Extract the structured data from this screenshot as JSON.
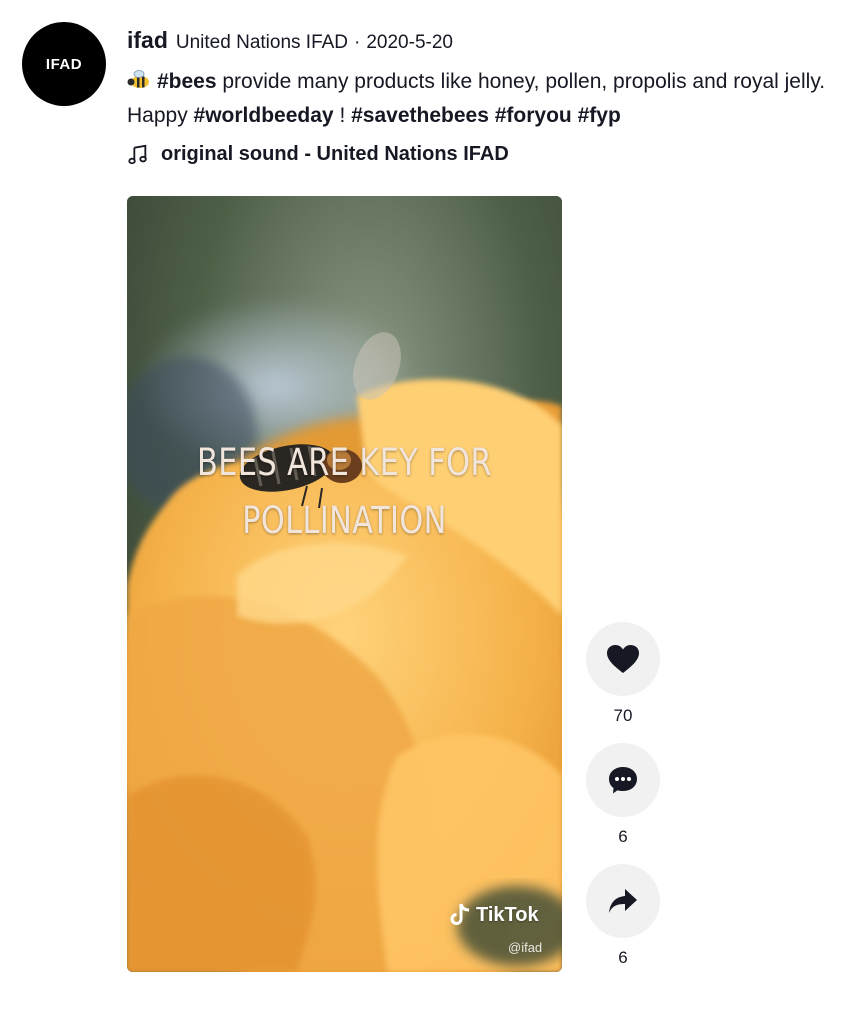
{
  "author": {
    "avatar_text": "IFAD",
    "username": "ifad",
    "nickname": "United Nations IFAD",
    "separator": "·",
    "date": "2020-5-20"
  },
  "caption": {
    "emoji": "bee-emoji",
    "part1_tag": "#bees",
    "part1_text": " provide many products like honey, pollen, propolis and royal jelly. Happy ",
    "tag2": "#worldbeeday",
    "part2_text": " ! ",
    "tag3": "#savethebees",
    "tag4": "#foryou",
    "tag5": "#fyp"
  },
  "sound": {
    "icon": "music-note-icon",
    "label": "original sound - United Nations IFAD"
  },
  "video": {
    "overlay_line1": "BEES ARE KEY FOR",
    "overlay_line2": "POLLINATION",
    "watermark_brand": "TikTok",
    "watermark_handle": "@ifad"
  },
  "actions": {
    "likes": "70",
    "comments": "6",
    "shares": "6"
  },
  "colors": {
    "text": "#161823",
    "button_bg": "#f1f1f2",
    "flower": "#f5b24a"
  }
}
